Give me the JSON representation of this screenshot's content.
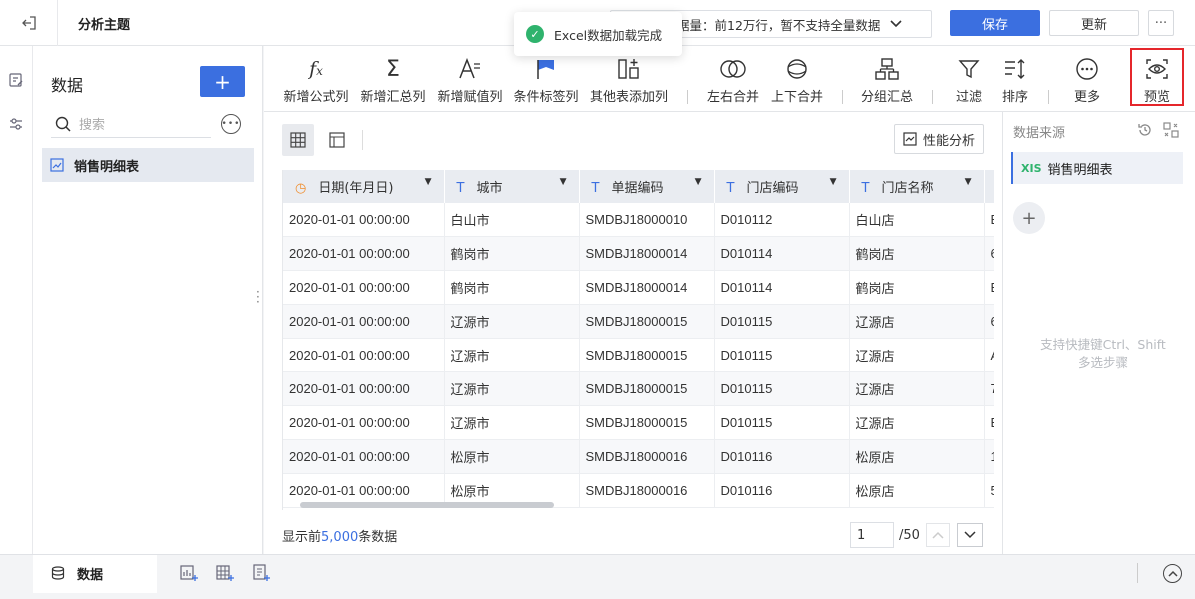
{
  "header": {
    "title": "分析主题",
    "limit_text": "据量：前12万行，暂不支持全量数据",
    "save_label": "保存",
    "update_label": "更新",
    "more_label": "···"
  },
  "toast": {
    "message": "Excel数据加载完成"
  },
  "data_panel": {
    "title": "数据",
    "add_label": "+",
    "search_placeholder": "搜索",
    "table_name": "销售明细表"
  },
  "toolbar": {
    "items": [
      {
        "label": "新增公式列",
        "icon": "fx-icon"
      },
      {
        "label": "新增汇总列",
        "icon": "sigma-icon"
      },
      {
        "label": "新增赋值列",
        "icon": "assign-icon"
      },
      {
        "label": "条件标签列",
        "icon": "flag-icon"
      },
      {
        "label": "其他表添加列",
        "icon": "add-column-icon"
      },
      {
        "label": "左右合并",
        "icon": "merge-horizontal-icon"
      },
      {
        "label": "上下合并",
        "icon": "merge-vertical-icon"
      },
      {
        "label": "分组汇总",
        "icon": "group-icon"
      },
      {
        "label": "过滤",
        "icon": "filter-icon"
      },
      {
        "label": "排序",
        "icon": "sort-icon"
      },
      {
        "label": "更多",
        "icon": "more-icon"
      },
      {
        "label": "预览",
        "icon": "eye-icon"
      }
    ]
  },
  "main": {
    "perf_label": "性能分析",
    "columns": [
      {
        "label": "日期(年月日)",
        "type": "date"
      },
      {
        "label": "城市",
        "type": "text"
      },
      {
        "label": "单据编码",
        "type": "text"
      },
      {
        "label": "门店编码",
        "type": "text"
      },
      {
        "label": "门店名称",
        "type": "text"
      }
    ],
    "rows": [
      [
        "2020-01-01 00:00:00",
        "白山市",
        "SMDBJ18000010",
        "D010112",
        "白山店",
        "E"
      ],
      [
        "2020-01-01 00:00:00",
        "鹤岗市",
        "SMDBJ18000014",
        "D010114",
        "鹤岗店",
        "6"
      ],
      [
        "2020-01-01 00:00:00",
        "鹤岗市",
        "SMDBJ18000014",
        "D010114",
        "鹤岗店",
        "E"
      ],
      [
        "2020-01-01 00:00:00",
        "辽源市",
        "SMDBJ18000015",
        "D010115",
        "辽源店",
        "6"
      ],
      [
        "2020-01-01 00:00:00",
        "辽源市",
        "SMDBJ18000015",
        "D010115",
        "辽源店",
        "A"
      ],
      [
        "2020-01-01 00:00:00",
        "辽源市",
        "SMDBJ18000015",
        "D010115",
        "辽源店",
        "7"
      ],
      [
        "2020-01-01 00:00:00",
        "辽源市",
        "SMDBJ18000015",
        "D010115",
        "辽源店",
        "E"
      ],
      [
        "2020-01-01 00:00:00",
        "松原市",
        "SMDBJ18000016",
        "D010116",
        "松原店",
        "1"
      ],
      [
        "2020-01-01 00:00:00",
        "松原市",
        "SMDBJ18000016",
        "D010116",
        "松原店",
        "5"
      ]
    ],
    "footer_prefix": "显示前",
    "footer_count": "5,000",
    "footer_suffix": "条数据",
    "page_current": "1",
    "page_total": "/50"
  },
  "right_panel": {
    "title": "数据来源",
    "source_tag": "XIS",
    "source_name": "销售明细表",
    "plus_label": "+",
    "hint_line1": "支持快捷键Ctrl、Shift",
    "hint_line2": "多选步骤"
  },
  "bottom": {
    "tab_label": "数据"
  },
  "colors": {
    "accent": "#3b6fe0",
    "success": "#2fb36d",
    "highlight": "#e5262b"
  }
}
